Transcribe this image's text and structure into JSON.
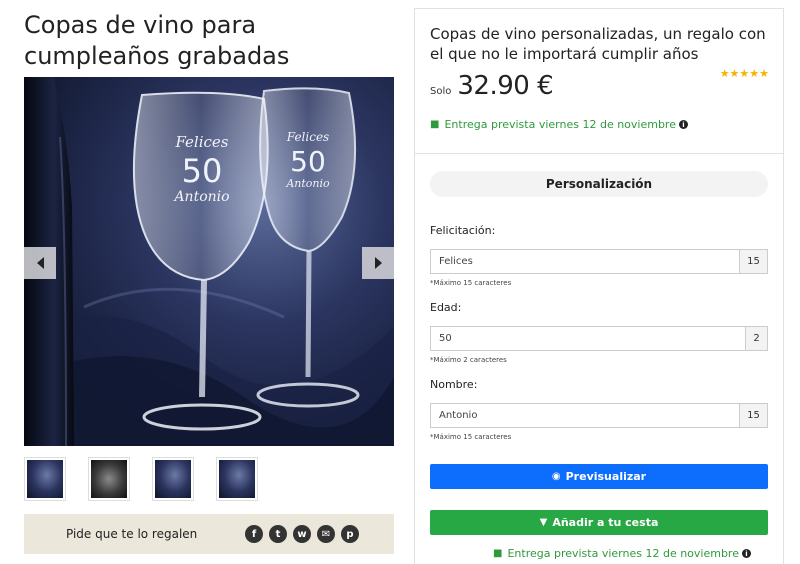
{
  "product": {
    "title": "Copas de vino para cumpleaños grabadas"
  },
  "gallery": {
    "engraving": {
      "line1": "Felices",
      "line2": "50",
      "line3": "Antonio"
    },
    "prev_icon": "chevron-left-icon",
    "next_icon": "chevron-right-icon",
    "thumbnail_count": 4
  },
  "share": {
    "label": "Pide que te lo regalen",
    "icons": [
      {
        "name": "facebook-icon",
        "glyph": "f"
      },
      {
        "name": "twitter-icon",
        "glyph": "t"
      },
      {
        "name": "whatsapp-icon",
        "glyph": "w"
      },
      {
        "name": "email-icon",
        "glyph": "✉"
      },
      {
        "name": "pinterest-icon",
        "glyph": "p"
      }
    ]
  },
  "panel": {
    "subtitle": "Copas de vino personalizadas, un regalo con el que no le importará cumplir años",
    "price_prefix": "Solo",
    "price": "32.90 €",
    "rating_stars": "★★★★★",
    "delivery_text": "Entrega prevista viernes 12 de noviembre",
    "section_title": "Personalización",
    "fields": [
      {
        "label": "Felicitación:",
        "value": "Felices",
        "count": "15",
        "hint": "*Máximo 15 caracteres"
      },
      {
        "label": "Edad:",
        "value": "50",
        "count": "2",
        "hint": "*Máximo 2 caracteres"
      },
      {
        "label": "Nombre:",
        "value": "Antonio",
        "count": "15",
        "hint": "*Máximo 15 caracteres"
      }
    ],
    "preview_button": "Previsualizar",
    "cart_button": "Añadir a tu cesta",
    "delivery_bottom": "Entrega prevista viernes 12 de noviembre"
  },
  "colors": {
    "accent_blue": "#0d6efd",
    "accent_green": "#28a745",
    "delivery_green": "#2f9a3c",
    "star_yellow": "#f5b400",
    "share_bg": "#ebe7da"
  }
}
